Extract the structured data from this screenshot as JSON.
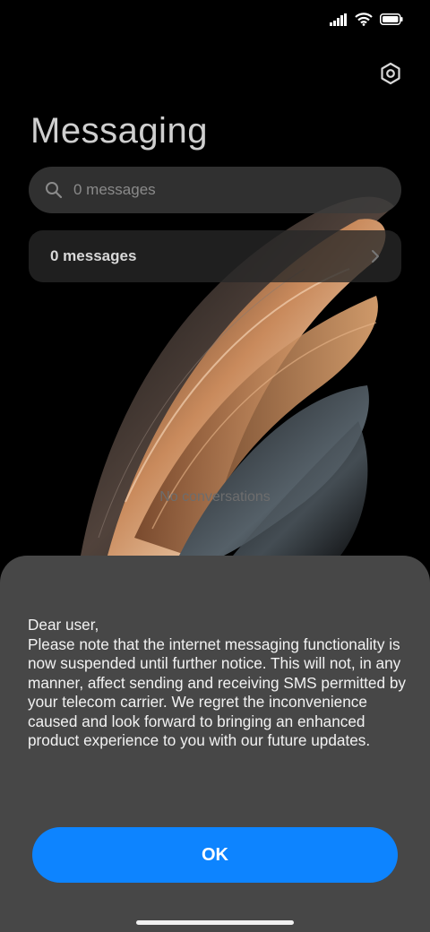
{
  "status_bar": {
    "icons": [
      "signal-icon",
      "wifi-icon",
      "battery-icon"
    ]
  },
  "header": {
    "title": "Messaging",
    "settings_icon": "gear-icon"
  },
  "search": {
    "icon": "search-icon",
    "placeholder": "0 messages"
  },
  "messages_card": {
    "label": "0 messages",
    "icon": "chevron-right-icon"
  },
  "empty_state": {
    "text": "No conversations"
  },
  "dialog": {
    "greeting": "Dear user,",
    "body": "Please note that the internet messaging functionality is now suspended until further notice. This will not, in any manner, affect sending and receiving SMS permitted by your telecom carrier. We regret the inconvenience caused and look forward to bringing an enhanced product experience to you with our future updates.",
    "ok_label": "OK"
  },
  "colors": {
    "background": "#000000",
    "sheet": "#474747",
    "accent": "#0d84ff"
  }
}
